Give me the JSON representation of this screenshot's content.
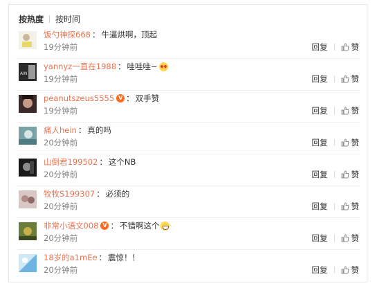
{
  "sort": {
    "hot_label": "按热度",
    "time_label": "按时间"
  },
  "actions": {
    "reply_label": "回复",
    "like_label": "赞"
  },
  "comments": [
    {
      "user": "饭勺神探668",
      "text": "牛逼烘啊，顶起",
      "time": "19分钟前",
      "verified": false,
      "emoji": ""
    },
    {
      "user": "yannyz一直在1988",
      "text": "哇哇哇~",
      "time": "19分钟前",
      "verified": false,
      "emoji": "heart-eyes"
    },
    {
      "user": "peanutszeus5555",
      "text": "双手赞",
      "time": "19分钟前",
      "verified": true,
      "emoji": ""
    },
    {
      "user": "痛人hein",
      "text": "真的吗",
      "time": "20分钟前",
      "verified": false,
      "emoji": ""
    },
    {
      "user": "山倒君199502",
      "text": "这个NB",
      "time": "20分钟前",
      "verified": false,
      "emoji": ""
    },
    {
      "user": "牧牧S199307",
      "text": "必须的",
      "time": "20分钟前",
      "verified": false,
      "emoji": ""
    },
    {
      "user": "非常小语文008",
      "text": "不错啊这个",
      "time": "20分钟前",
      "verified": true,
      "emoji": "grin"
    },
    {
      "user": "18岁的a1mEe",
      "text": "震惊！！",
      "time": "20分钟前",
      "verified": false,
      "emoji": ""
    }
  ],
  "colors": {
    "username": "#eb7350",
    "text": "#333333",
    "muted": "#808080",
    "verified_badge": "#ff6a1e"
  }
}
